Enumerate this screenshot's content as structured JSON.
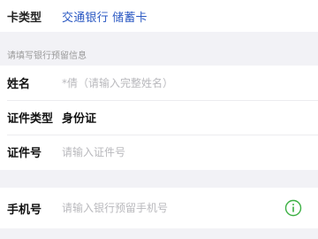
{
  "card": {
    "label": "卡类型",
    "value": "交通银行 储蓄卡"
  },
  "section": {
    "title": "请填写银行预留信息"
  },
  "form": {
    "name": {
      "label": "姓名",
      "placeholder": "*倩（请输入完整姓名）"
    },
    "id_type": {
      "label": "证件类型",
      "value": "身份证"
    },
    "id_number": {
      "label": "证件号",
      "placeholder": "请输入证件号"
    },
    "phone": {
      "label": "手机号",
      "placeholder": "请输入银行预留手机号"
    }
  },
  "icons": {
    "phone_info": "info-circle-icon"
  },
  "colors": {
    "bank_link": "#2b59c3",
    "info_icon": "#3cb043",
    "background": "#f2f2f6"
  }
}
